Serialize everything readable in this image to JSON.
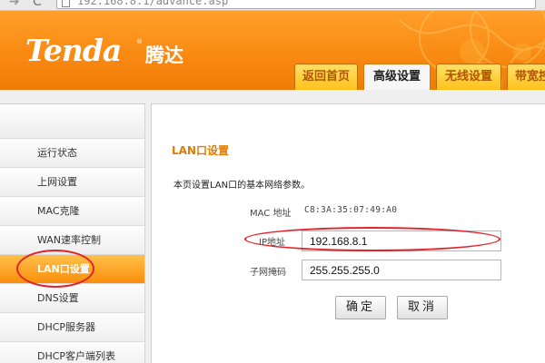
{
  "browser": {
    "url": "192.168.8.1/advance.asp"
  },
  "header": {
    "logo_text": "Tenda",
    "logo_cn": "腾达",
    "tabs": [
      {
        "label": "返回首页"
      },
      {
        "label": "高级设置",
        "active": true
      },
      {
        "label": "无线设置"
      },
      {
        "label": "带宽控"
      }
    ]
  },
  "sidebar": {
    "items": [
      {
        "label": "运行状态"
      },
      {
        "label": "上网设置"
      },
      {
        "label": "MAC克隆"
      },
      {
        "label": "WAN速率控制"
      },
      {
        "label": "LAN口设置",
        "active": true
      },
      {
        "label": "DNS设置"
      },
      {
        "label": "DHCP服务器"
      },
      {
        "label": "DHCP客户端列表"
      }
    ]
  },
  "content": {
    "title": "LAN口设置",
    "description": "本页设置LAN口的基本网络参数。",
    "mac_label": "MAC 地址",
    "mac_value": "C8:3A:35:07:49:A0",
    "ip_label": "IP地址",
    "ip_value": "192.168.8.1",
    "mask_label": "子网掩码",
    "mask_value": "255.255.255.0",
    "ok_label": "确定",
    "cancel_label": "取消"
  },
  "colors": {
    "header_orange": "#f98a12",
    "accent_text": "#e07a00",
    "annotation_red": "#e0242a"
  }
}
